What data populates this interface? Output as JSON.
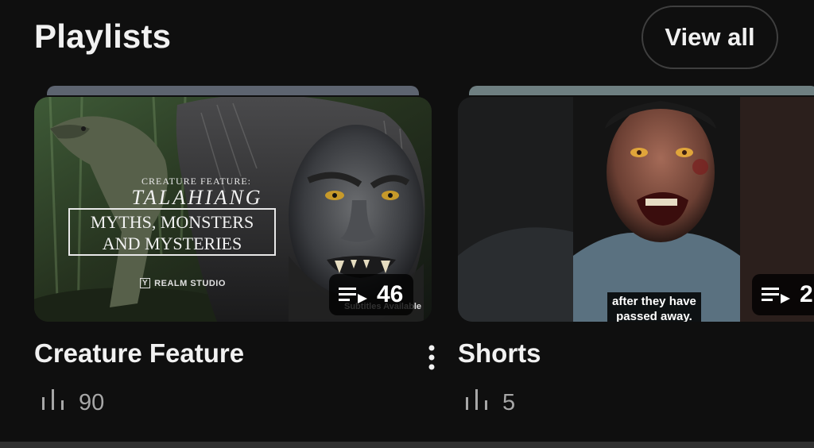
{
  "header": {
    "title": "Playlists",
    "view_all_label": "View all"
  },
  "playlists": [
    {
      "title": "Creature Feature",
      "video_count": "46",
      "stat_value": "90",
      "thumbnail": {
        "kicker": "CREATURE FEATURE:",
        "headline": "TALAHIANG",
        "box_line1": "MYTHS, MONSTERS",
        "box_line2": "AND MYSTERIES",
        "studio": "REALM STUDIO",
        "studio_logo_letter": "Y",
        "footer_text": "Subtitles Available"
      }
    },
    {
      "title": "Shorts",
      "video_count": "2",
      "stat_value": "5",
      "thumbnail": {
        "caption_line1": "after they have",
        "caption_line2": "passed away."
      }
    }
  ],
  "icons": {
    "playlist": "playlist-queue-icon",
    "stats": "bar-stats-icon",
    "more": "more-vertical-icon"
  },
  "colors": {
    "background": "#0f0f0f",
    "text": "#f1f1f1",
    "muted": "#a7a7a7",
    "button_border": "#3f3f3f"
  }
}
